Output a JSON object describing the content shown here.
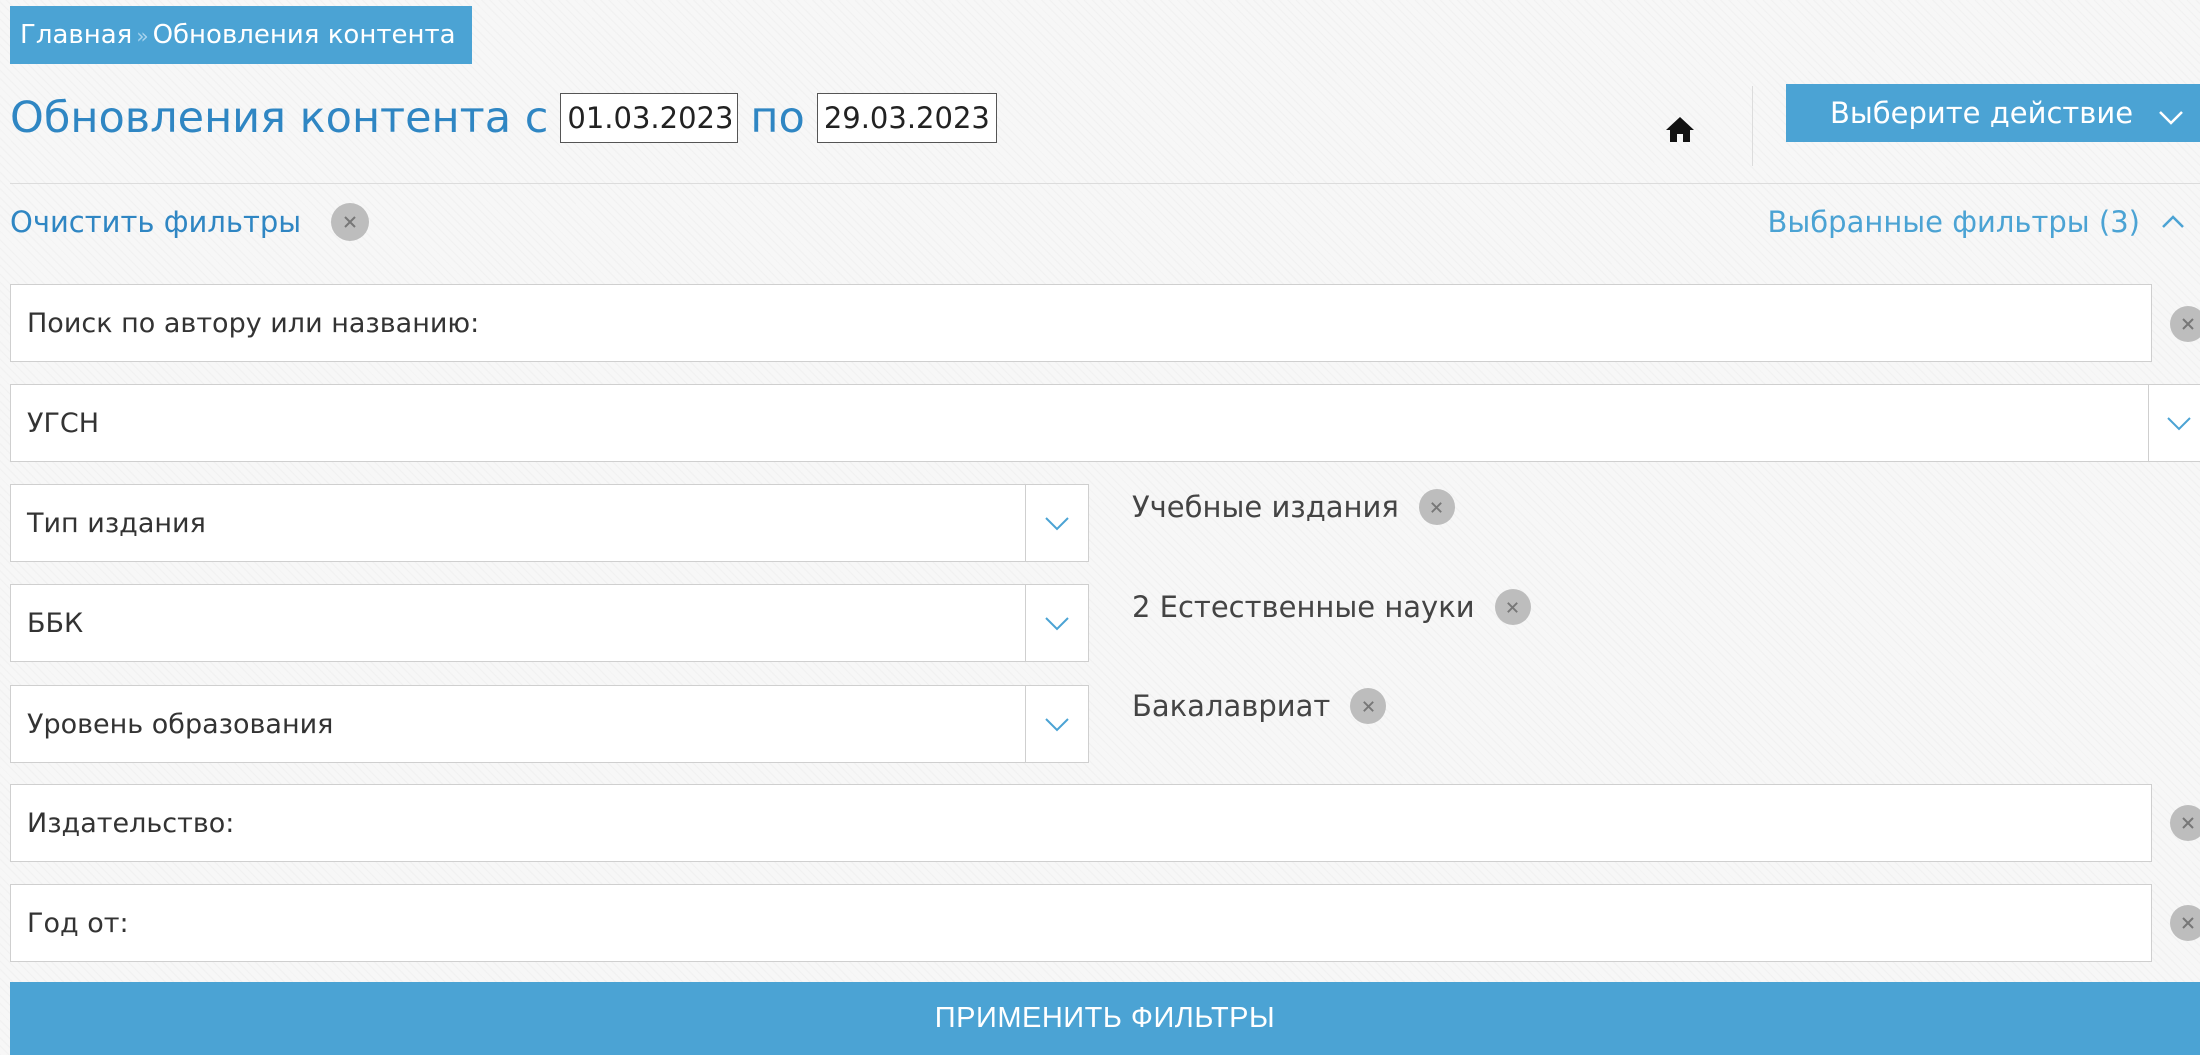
{
  "breadcrumb": {
    "home": "Главная",
    "separator": "»",
    "current": "Обновления контента"
  },
  "title": {
    "prefix": "Обновления контента с",
    "date_from": "01.03.2023",
    "middle": "по",
    "date_to": "29.03.2023"
  },
  "actions": {
    "select_action_label": "Выберите действие"
  },
  "filters_bar": {
    "clear_label": "Очистить фильтры",
    "selected_label": "Выбранные фильтры (3)"
  },
  "fields": {
    "search_placeholder": "Поиск по автору или названию:",
    "ugsn_label": "УГСН",
    "edition_type_label": "Тип издания",
    "bbk_label": "ББК",
    "education_level_label": "Уровень образования",
    "publisher_placeholder": "Издательство:",
    "year_from_placeholder": "Год от:"
  },
  "selected_tags": {
    "edition_type": "Учебные издания",
    "bbk": "2 Естественные науки",
    "education_level": "Бакалавриат"
  },
  "apply_label": "ПРИМЕНИТЬ ФИЛЬТРЫ",
  "colors": {
    "accent": "#4ba3d4",
    "title": "#2f86c3",
    "clear_circle": "#bdbdbd"
  },
  "icons": {
    "home": "home-icon",
    "chevron_down": "chevron-down-icon",
    "chevron_up": "chevron-up-icon",
    "close": "close-icon"
  }
}
